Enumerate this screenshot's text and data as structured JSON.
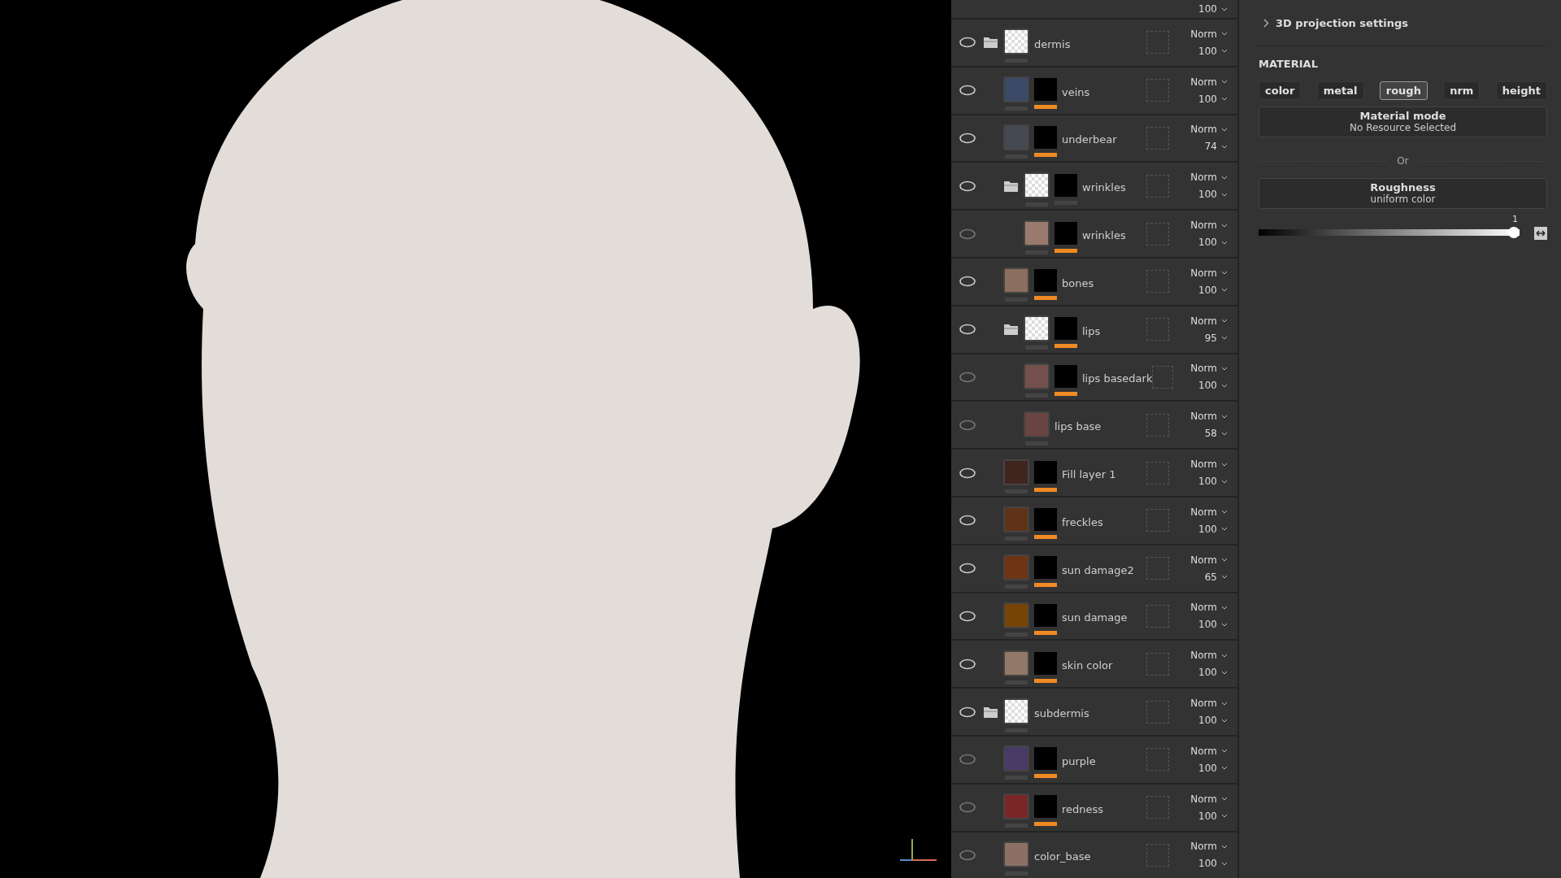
{
  "layers_panel": {
    "top_partial_row": {
      "opacity": "100"
    },
    "layers": [
      {
        "name": "dermis",
        "kind": "folder",
        "visible": true,
        "blend": "Norm",
        "opacity": "100",
        "children": [
          {
            "name": "veins",
            "kind": "fill",
            "visible": true,
            "color": "#3b4a66",
            "mask": true,
            "blend": "Norm",
            "opacity": "100"
          },
          {
            "name": "underbear",
            "kind": "fill",
            "visible": true,
            "color": "#454a52",
            "mask": true,
            "blend": "Norm",
            "opacity": "74"
          },
          {
            "name": "wrinkles",
            "kind": "folder",
            "visible": true,
            "mask": false,
            "blend": "Norm",
            "opacity": "100",
            "children": [
              {
                "name": "wrinkles",
                "kind": "fill",
                "visible": false,
                "color": "#9a7a6c",
                "mask": true,
                "blend": "Norm",
                "opacity": "100"
              }
            ]
          },
          {
            "name": "bones",
            "kind": "fill",
            "visible": true,
            "color": "#8c6e5e",
            "mask": true,
            "blend": "Norm",
            "opacity": "100"
          },
          {
            "name": "lips",
            "kind": "folder",
            "visible": true,
            "mask": true,
            "blend": "Norm",
            "opacity": "95",
            "children": [
              {
                "name": "lips basedark",
                "kind": "fill",
                "visible": false,
                "color": "#74504c",
                "mask": true,
                "blend": "Norm",
                "opacity": "100"
              },
              {
                "name": "lips base",
                "kind": "fill",
                "visible": false,
                "color": "#6a4442",
                "blend": "Norm",
                "opacity": "58"
              }
            ]
          },
          {
            "name": "Fill layer 1",
            "kind": "fill",
            "visible": true,
            "color": "#40241e",
            "mask": true,
            "blend": "Norm",
            "opacity": "100"
          },
          {
            "name": "freckles",
            "kind": "fill",
            "visible": true,
            "color": "#5e3318",
            "mask": true,
            "blend": "Norm",
            "opacity": "100"
          },
          {
            "name": "sun damage2",
            "kind": "fill",
            "visible": true,
            "color": "#6e3414",
            "mask": true,
            "blend": "Norm",
            "opacity": "65"
          },
          {
            "name": "sun damage",
            "kind": "fill",
            "visible": true,
            "color": "#764404",
            "mask": true,
            "blend": "Norm",
            "opacity": "100"
          },
          {
            "name": "skin color",
            "kind": "fill",
            "visible": true,
            "color": "#927866",
            "mask": true,
            "blend": "Norm",
            "opacity": "100"
          }
        ]
      },
      {
        "name": "subdermis",
        "kind": "folder",
        "visible": true,
        "blend": "Norm",
        "opacity": "100",
        "children": [
          {
            "name": "purple",
            "kind": "fill",
            "visible": false,
            "color": "#4a3a66",
            "mask": true,
            "blend": "Norm",
            "opacity": "100"
          },
          {
            "name": "redness",
            "kind": "fill",
            "visible": false,
            "color": "#7a2626",
            "mask": true,
            "blend": "Norm",
            "opacity": "100"
          },
          {
            "name": "color_base",
            "kind": "fill",
            "visible": false,
            "color": "#8c7066",
            "blend": "Norm",
            "opacity": "100"
          }
        ]
      }
    ]
  },
  "properties": {
    "projection_section": {
      "title": "3D projection settings",
      "expanded": false
    },
    "material": {
      "heading": "MATERIAL",
      "channels": [
        {
          "label": "color",
          "selected": false
        },
        {
          "label": "metal",
          "selected": false
        },
        {
          "label": "rough",
          "selected": true
        },
        {
          "label": "nrm",
          "selected": false
        },
        {
          "label": "height",
          "selected": false
        }
      ],
      "mode_box": {
        "title": "Material mode",
        "subtitle": "No Resource Selected"
      },
      "separator": "Or",
      "channel_box": {
        "title": "Roughness",
        "subtitle": "uniform color"
      },
      "slider": {
        "reading": "1",
        "level": 1
      }
    }
  }
}
